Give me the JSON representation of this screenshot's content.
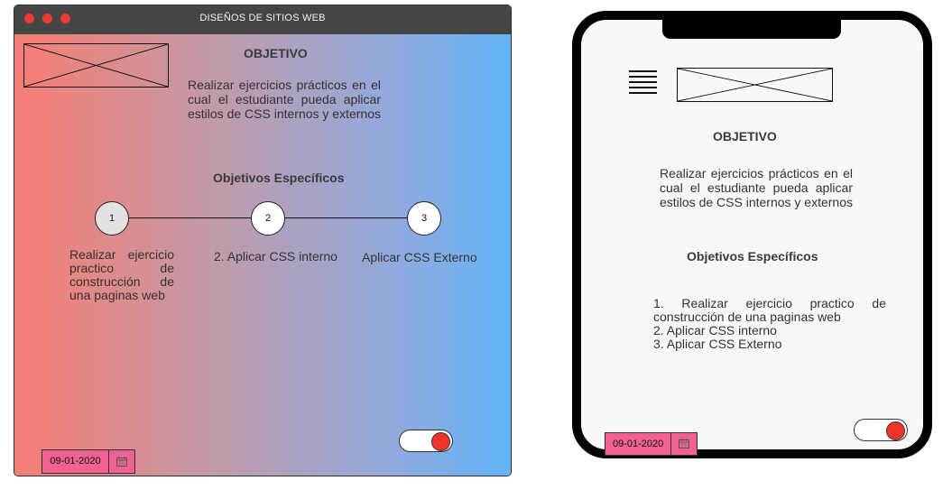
{
  "desktop": {
    "window_title": "DISEÑOS DE SITIOS WEB",
    "traffic_lights": [
      "#ee3b34",
      "#ee3b34",
      "#ee3b34"
    ],
    "objective_heading": "OBJETIVO",
    "objective_text": "Realizar ejercicios prácticos en el cual el estudiante pueda aplicar estilos de CSS internos y externos",
    "specific_heading": "Objetivos Específicos",
    "steps": [
      {
        "number": "1",
        "label": "Realizar ejercicio practico de construcción de una paginas web"
      },
      {
        "number": "2",
        "label": "2. Aplicar CSS interno"
      },
      {
        "number": "3",
        "label": "Aplicar CSS Externo"
      }
    ],
    "date_value": "09-01-2020",
    "toggle_on": true
  },
  "mobile": {
    "objective_heading": "OBJETIVO",
    "objective_text": "Realizar ejercicios prácticos en el cual el estudiante pueda aplicar estilos de CSS internos y externos",
    "specific_heading": "Objetivos Específicos",
    "list_items": [
      "1. Realizar ejercicio practico de construcción de una paginas web",
      "2. Aplicar CSS interno",
      "3. Aplicar CSS Externo"
    ],
    "date_value": "09-01-2020",
    "toggle_on": true
  },
  "colors": {
    "gradient_start": "#f28079",
    "gradient_end": "#61b4f7",
    "toggle_knob": "#f0342a",
    "date_field": "#ef6292",
    "titlebar": "#454545"
  },
  "icons": [
    "image-placeholder-icon",
    "calendar-icon",
    "hamburger-menu-icon"
  ]
}
